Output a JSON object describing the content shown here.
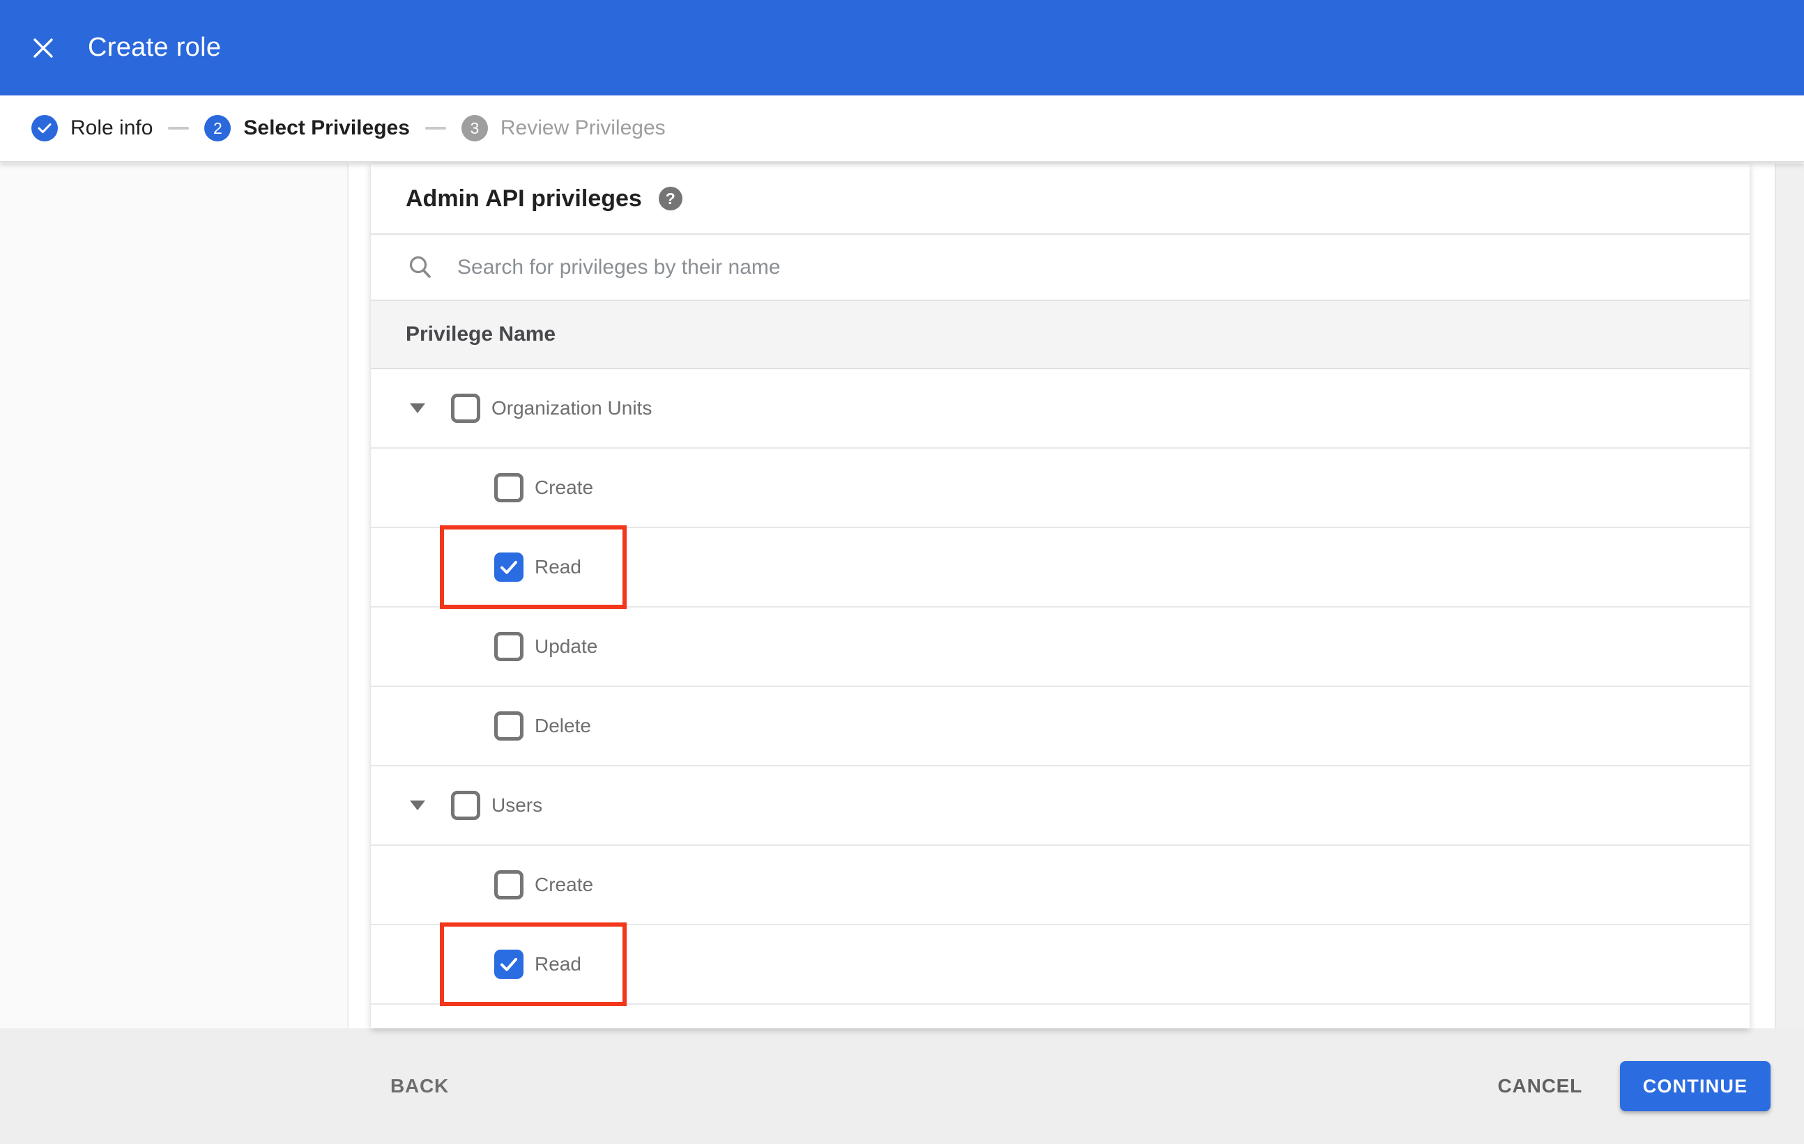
{
  "header": {
    "title": "Create role"
  },
  "stepper": {
    "steps": [
      {
        "label": "Role info",
        "status": "done"
      },
      {
        "label": "Select Privileges",
        "status": "active",
        "number": "2"
      },
      {
        "label": "Review Privileges",
        "status": "upcoming",
        "number": "3"
      }
    ]
  },
  "privileges_panel": {
    "title": "Admin API privileges",
    "help_icon_glyph": "?",
    "search_placeholder": "Search for privileges by their name",
    "column_header": "Privilege Name",
    "rows": [
      {
        "label": "Organization Units",
        "level": "group",
        "checked": false,
        "expanded": true,
        "highlighted": false
      },
      {
        "label": "Create",
        "level": "child",
        "checked": false,
        "highlighted": false
      },
      {
        "label": "Read",
        "level": "child",
        "checked": true,
        "highlighted": true
      },
      {
        "label": "Update",
        "level": "child",
        "checked": false,
        "highlighted": false
      },
      {
        "label": "Delete",
        "level": "child",
        "checked": false,
        "highlighted": false
      },
      {
        "label": "Users",
        "level": "group",
        "checked": false,
        "expanded": true,
        "highlighted": false
      },
      {
        "label": "Create",
        "level": "child",
        "checked": false,
        "highlighted": false
      },
      {
        "label": "Read",
        "level": "child",
        "checked": true,
        "highlighted": true
      }
    ]
  },
  "footer": {
    "back_label": "BACK",
    "cancel_label": "CANCEL",
    "continue_label": "CONTINUE"
  },
  "colors": {
    "accent_blue": "#2a68dc",
    "checked_checkbox_blue": "#2a6ce2",
    "continue_button_blue": "#2b6ce1",
    "highlight_red": "#f2371b",
    "footer_background": "#eeeeee",
    "table_header_background": "#f4f4f5",
    "sidebar_background": "#fafafa"
  }
}
